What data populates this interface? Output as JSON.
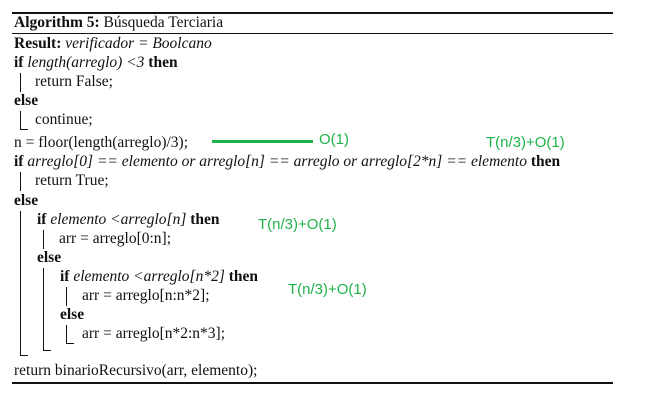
{
  "algorithm": {
    "label": "Algorithm 5:",
    "title": "Búsqueda Terciaria"
  },
  "lines": {
    "result_kw": "Result:",
    "result_body": "verificador = Boolcano",
    "if1_kw": "if",
    "if1_cond": "length(arreglo) <3",
    "if1_then": "then",
    "ret_false": "return False;",
    "else1": "else",
    "continue": "continue;",
    "n_assign": "n = floor(length(arreglo)/3);",
    "if2_kw": "if",
    "if2_cond": "arreglo[0] == elemento or arreglo[n] == arreglo or arreglo[2*n] == elemento",
    "if2_then": "then",
    "ret_true": "return True;",
    "else2": "else",
    "if3_kw": "if",
    "if3_cond": "elemento <arreglo[n]",
    "if3_then": "then",
    "arr1": "arr = arreglo[0:n];",
    "else3": "else",
    "if4_kw": "if",
    "if4_cond": "elemento <arreglo[n*2]",
    "if4_then": "then",
    "arr2": "arr = arreglo[n:n*2];",
    "else4": "else",
    "arr3": "arr = arreglo[n*2:n*3];",
    "ret_rec": "return binarioRecursivo(arr, elemento);"
  },
  "annotations": {
    "o1": "O(1)",
    "t1": "T(n/3)+O(1)",
    "t2": "T(n/3)+O(1)",
    "t3": "T(n/3)+O(1)"
  },
  "colors": {
    "annotation": "#1fb34a",
    "text": "#111111"
  }
}
